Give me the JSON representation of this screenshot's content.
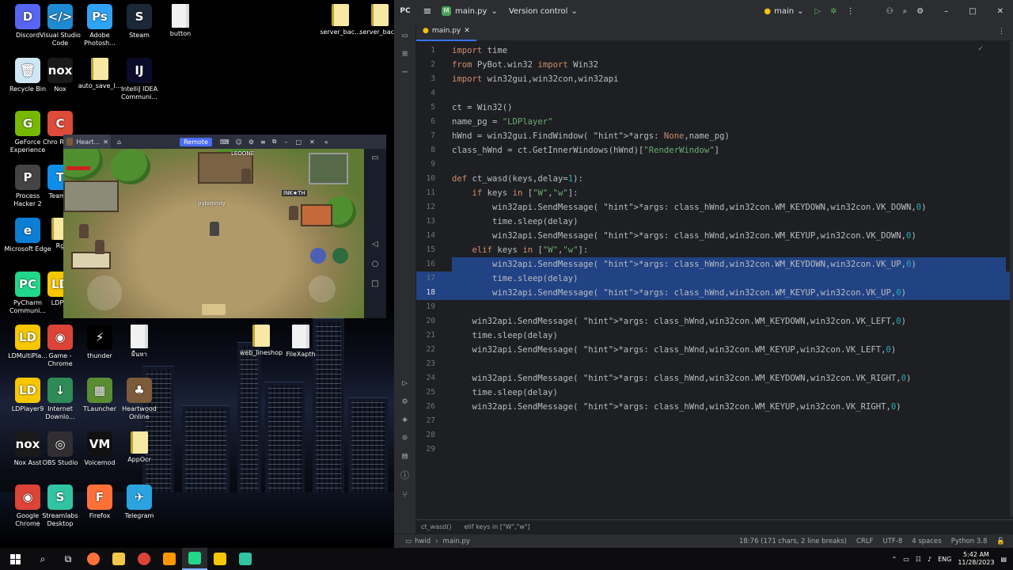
{
  "desktop": {
    "icons": [
      {
        "label": "Discord",
        "glyph": "D",
        "color": "#5865f2"
      },
      {
        "label": "Visual Studio Code",
        "glyph": "&lt;/&gt;",
        "color": "#1f8ad2"
      },
      {
        "label": "Adobe Photosh...",
        "glyph": "Ps",
        "color": "#2fa3f7"
      },
      {
        "label": "Steam",
        "glyph": "S",
        "color": "#1b2838"
      },
      {
        "label": "button",
        "glyph": "",
        "color": "#eeeeee"
      },
      {
        "label": "Recycle Bin",
        "glyph": "🗑",
        "color": "#cfe6f5"
      },
      {
        "label": "Nox",
        "glyph": "nox",
        "color": "#1a1a1a"
      },
      {
        "label": "auto_save_l...",
        "glyph": "",
        "color": "#f7e8a4"
      },
      {
        "label": "IntelliJ IDEA Communi...",
        "glyph": "IJ",
        "color": "#0b0b2a"
      },
      {
        "label": "GeForce Experience",
        "glyph": "G",
        "color": "#76b900"
      },
      {
        "label": "Chro Remo",
        "glyph": "C",
        "color": "#dd4b39"
      },
      {
        "label": "Process Hacker 2",
        "glyph": "P",
        "color": "#444"
      },
      {
        "label": "TeamVi",
        "glyph": "T",
        "color": "#0e8ee9"
      },
      {
        "label": "Microsoft Edge",
        "glyph": "e",
        "color": "#0c7ed4"
      },
      {
        "label": "Rg",
        "glyph": "",
        "color": "#f7e8a4"
      },
      {
        "label": "PyCharm Communi...",
        "glyph": "PC",
        "color": "#21d789"
      },
      {
        "label": "LDPla",
        "glyph": "LD",
        "color": "#f6c700"
      },
      {
        "label": "LDMultiPla...",
        "glyph": "LD",
        "color": "#f6c700"
      },
      {
        "label": "Game - Chrome",
        "glyph": "◉",
        "color": "#db4437"
      },
      {
        "label": "thunder",
        "glyph": "⚡",
        "color": "#000"
      },
      {
        "label": "ผื่นหา",
        "glyph": "",
        "color": "#eeeeee"
      },
      {
        "label": "web_lineshop",
        "glyph": "",
        "color": "#f7e8a4"
      },
      {
        "label": "FileXapth",
        "glyph": "",
        "color": "#eeeeee"
      },
      {
        "label": "LDPlayer9",
        "glyph": "LD",
        "color": "#f6c700"
      },
      {
        "label": "Internet Downlo...",
        "glyph": "↓",
        "color": "#2e8b57"
      },
      {
        "label": "TLauncher",
        "glyph": "▦",
        "color": "#5b8c32"
      },
      {
        "label": "Heartwood Online",
        "glyph": "♣",
        "color": "#7b5b3a"
      },
      {
        "label": "Nox Asst",
        "glyph": "nox",
        "color": "#1a1a1a"
      },
      {
        "label": "OBS Studio",
        "glyph": "◎",
        "color": "#302e31"
      },
      {
        "label": "Voicemod",
        "glyph": "VM",
        "color": "#111"
      },
      {
        "label": "AppOcr",
        "glyph": "",
        "color": "#f7e8a4"
      },
      {
        "label": "Google Chrome",
        "glyph": "◉",
        "color": "#db4437"
      },
      {
        "label": "Streamlabs Desktop",
        "glyph": "S",
        "color": "#31c3a2"
      },
      {
        "label": "Firefox",
        "glyph": "F",
        "color": "#ff7139"
      },
      {
        "label": "Telegram",
        "glyph": "✈",
        "color": "#2aa3df"
      },
      {
        "label": "server_bac...",
        "glyph": "",
        "color": "#f7e8a4"
      },
      {
        "label": "server_bac...",
        "glyph": "",
        "color": "#f7e8a4"
      }
    ]
  },
  "emulator": {
    "tab_title": "Heart...",
    "remote_label": "Remote",
    "player_name": "pybotindy",
    "npc_name": "LEOONE",
    "npc2": "INK★TH"
  },
  "ide": {
    "project_badge": "M",
    "project": "main.py",
    "vcs": "Version control",
    "run_config": "main",
    "tab": "main.py",
    "lines": [
      "import time",
      "from PyBot.win32 import Win32",
      "import win32gui,win32con,win32api",
      "",
      "ct = Win32()",
      "name_pg = \"LDPlayer\"",
      "hWnd = win32gui.FindWindow( *args: None,name_pg)",
      "class_hWnd = ct.GetInnerWindows(hWnd)[\"RenderWindow\"]",
      "",
      "def ct_wasd(keys,delay=1):",
      "    if keys in [\"W\",\"w\"]:",
      "        win32api.SendMessage( *args: class_hWnd,win32con.WM_KEYDOWN,win32con.VK_DOWN,0)",
      "        time.sleep(delay)",
      "        win32api.SendMessage( *args: class_hWnd,win32con.WM_KEYUP,win32con.VK_DOWN,0)",
      "    elif keys in [\"W\",\"w\"]:",
      "        win32api.SendMessage( *args: class_hWnd,win32con.WM_KEYDOWN,win32con.VK_UP,0)",
      "        time.sleep(delay)",
      "        win32api.SendMessage( *args: class_hWnd,win32con.WM_KEYUP,win32con.VK_UP,0)",
      "",
      "    win32api.SendMessage( *args: class_hWnd,win32con.WM_KEYDOWN,win32con.VK_LEFT,0)",
      "    time.sleep(delay)",
      "    win32api.SendMessage( *args: class_hWnd,win32con.WM_KEYUP,win32con.VK_LEFT,0)",
      "",
      "    win32api.SendMessage( *args: class_hWnd,win32con.WM_KEYDOWN,win32con.VK_RIGHT,0)",
      "    time.sleep(delay)",
      "    win32api.SendMessage( *args: class_hWnd,win32con.WM_KEYUP,win32con.VK_RIGHT,0)",
      "",
      "",
      ""
    ],
    "current_line": 18,
    "selected_lines": [
      16,
      17,
      18
    ],
    "breadcrumb": [
      "ct_wasd()",
      "elif keys in [\"W\",\"w\"]"
    ],
    "status": {
      "path_root": "hwid",
      "path_file": "main.py",
      "position": "18:76 (171 chars, 2 line breaks)",
      "line_sep": "CRLF",
      "encoding": "UTF-8",
      "indent": "4 spaces",
      "interpreter": "Python 3.8"
    }
  },
  "taskbar": {
    "lang": "ENG",
    "time": "5:42 AM",
    "date": "11/28/2023"
  },
  "colors": {
    "selection": "#214283",
    "keyword": "#cf8e6d",
    "string": "#6aab73",
    "number": "#2aacb8",
    "accent": "#3574f0"
  }
}
